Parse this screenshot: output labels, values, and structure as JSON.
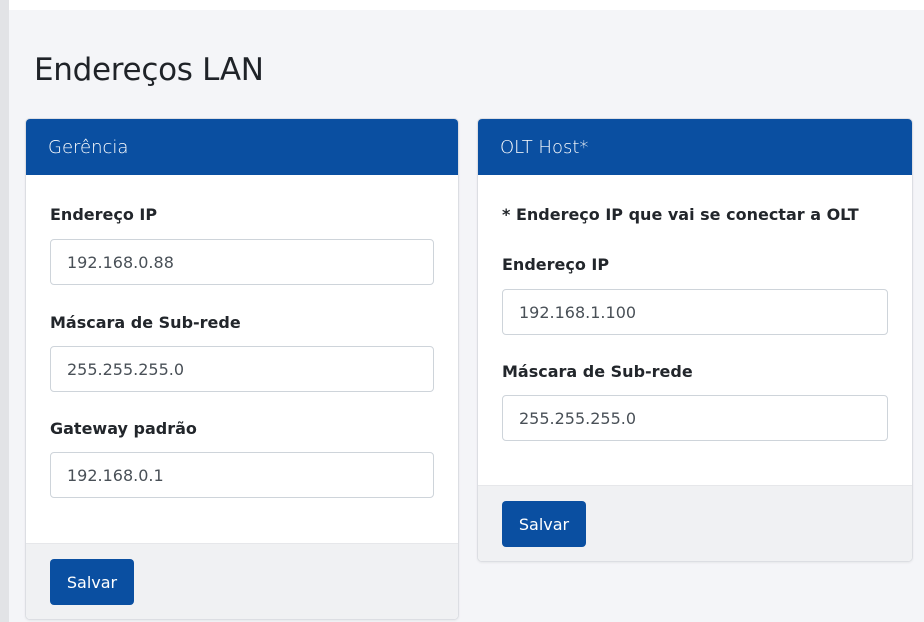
{
  "page": {
    "title": "Endereços LAN"
  },
  "gerencia": {
    "header": "Gerência",
    "ip_label": "Endereço IP",
    "ip_value": "192.168.0.88",
    "mask_label": "Máscara de Sub-rede",
    "mask_value": "255.255.255.0",
    "gateway_label": "Gateway padrão",
    "gateway_value": "192.168.0.1",
    "save_label": "Salvar"
  },
  "olt": {
    "header": "OLT Host*",
    "note": "* Endereço IP que vai se conectar a OLT",
    "ip_label": "Endereço IP",
    "ip_value": "192.168.1.100",
    "mask_label": "Máscara de Sub-rede",
    "mask_value": "255.255.255.0",
    "save_label": "Salvar"
  },
  "colors": {
    "primary": "#0a4fa1",
    "background": "#f4f5f8",
    "footer": "#f0f1f3"
  }
}
